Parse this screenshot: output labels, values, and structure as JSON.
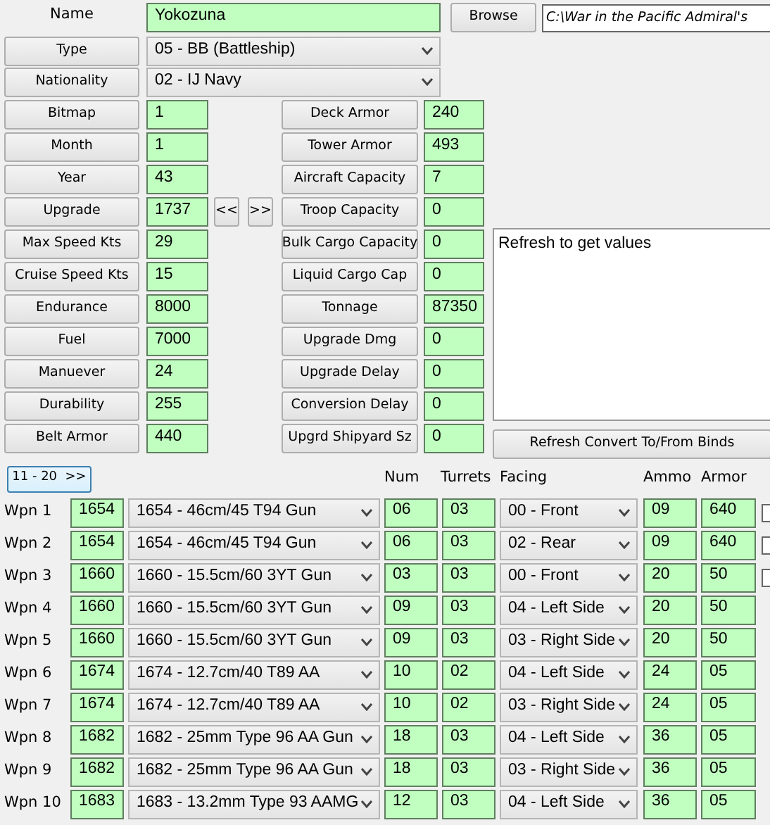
{
  "name_label": "Name",
  "name": "Yokozuna",
  "browse_button": "Browse",
  "path": "C:\\War in the Pacific Admiral's",
  "type": {
    "label": "Type",
    "value": "05 - BB (Battleship)"
  },
  "nationality": {
    "label": "Nationality",
    "value": "02 - IJ Navy"
  },
  "fields_left": [
    {
      "label": "Bitmap",
      "value": "1"
    },
    {
      "label": "Month",
      "value": "1"
    },
    {
      "label": "Year",
      "value": "43"
    },
    {
      "label": "Upgrade",
      "value": "1737",
      "nav": [
        "<<",
        ">>"
      ]
    },
    {
      "label": "Max Speed Kts",
      "value": "29"
    },
    {
      "label": "Cruise Speed Kts",
      "value": "15"
    },
    {
      "label": "Endurance",
      "value": "8000"
    },
    {
      "label": "Fuel",
      "value": "7000"
    },
    {
      "label": "Manuever",
      "value": "24"
    },
    {
      "label": "Durability",
      "value": "255"
    },
    {
      "label": "Belt Armor",
      "value": "440"
    }
  ],
  "fields_right": [
    {
      "label": "Deck Armor",
      "value": "240"
    },
    {
      "label": "Tower Armor",
      "value": "493"
    },
    {
      "label": "Aircraft Capacity",
      "value": "7"
    },
    {
      "label": "Troop Capacity",
      "value": "0"
    },
    {
      "label": "Bulk Cargo Capacity",
      "value": "0"
    },
    {
      "label": "Liquid Cargo Cap",
      "value": "0"
    },
    {
      "label": "Tonnage",
      "value": "87350"
    },
    {
      "label": "Upgrade Dmg",
      "value": "0"
    },
    {
      "label": "Upgrade Delay",
      "value": "0"
    },
    {
      "label": "Conversion Delay",
      "value": "0"
    },
    {
      "label": "Upgrd Shipyard Sz",
      "value": "0"
    }
  ],
  "notes": "Refresh to get values",
  "refresh_button": "Refresh Convert To/From Binds",
  "page_button": "11 - 20  >>",
  "weapon_columns": [
    "Num",
    "Turrets",
    "Facing",
    "Ammo",
    "Armor"
  ],
  "weapons": [
    {
      "label": "Wpn 1",
      "code": "1654",
      "device": "1654 - 46cm/45 T94 Gun",
      "num": "06",
      "turrets": "03",
      "facing": "00 - Front",
      "ammo": "09",
      "armor": "640"
    },
    {
      "label": "Wpn 2",
      "code": "1654",
      "device": "1654 - 46cm/45 T94 Gun",
      "num": "06",
      "turrets": "03",
      "facing": "02 - Rear",
      "ammo": "09",
      "armor": "640"
    },
    {
      "label": "Wpn 3",
      "code": "1660",
      "device": "1660 - 15.5cm/60 3YT Gun",
      "num": "03",
      "turrets": "03",
      "facing": "00 - Front",
      "ammo": "20",
      "armor": "50"
    },
    {
      "label": "Wpn 4",
      "code": "1660",
      "device": "1660 - 15.5cm/60 3YT Gun",
      "num": "09",
      "turrets": "03",
      "facing": "04 - Left Side",
      "ammo": "20",
      "armor": "50"
    },
    {
      "label": "Wpn 5",
      "code": "1660",
      "device": "1660 - 15.5cm/60 3YT Gun",
      "num": "09",
      "turrets": "03",
      "facing": "03 - Right Side",
      "ammo": "20",
      "armor": "50"
    },
    {
      "label": "Wpn 6",
      "code": "1674",
      "device": "1674 - 12.7cm/40 T89 AA",
      "num": "10",
      "turrets": "02",
      "facing": "04 - Left Side",
      "ammo": "24",
      "armor": "05"
    },
    {
      "label": "Wpn 7",
      "code": "1674",
      "device": "1674 - 12.7cm/40 T89 AA",
      "num": "10",
      "turrets": "02",
      "facing": "03 - Right Side",
      "ammo": "24",
      "armor": "05"
    },
    {
      "label": "Wpn 8",
      "code": "1682",
      "device": "1682 - 25mm Type 96 AA Gun",
      "num": "18",
      "turrets": "03",
      "facing": "04 - Left Side",
      "ammo": "36",
      "armor": "05"
    },
    {
      "label": "Wpn 9",
      "code": "1682",
      "device": "1682 - 25mm Type 96 AA Gun",
      "num": "18",
      "turrets": "03",
      "facing": "03 - Right Side",
      "ammo": "36",
      "armor": "05"
    },
    {
      "label": "Wpn 10",
      "code": "1683",
      "device": "1683 - 13.2mm Type 93 AAMG",
      "num": "12",
      "turrets": "03",
      "facing": "04 - Left Side",
      "ammo": "36",
      "armor": "05"
    }
  ],
  "checkboxes": [
    {
      "checked": false
    },
    {
      "checked": false
    },
    {
      "checked": false
    }
  ]
}
